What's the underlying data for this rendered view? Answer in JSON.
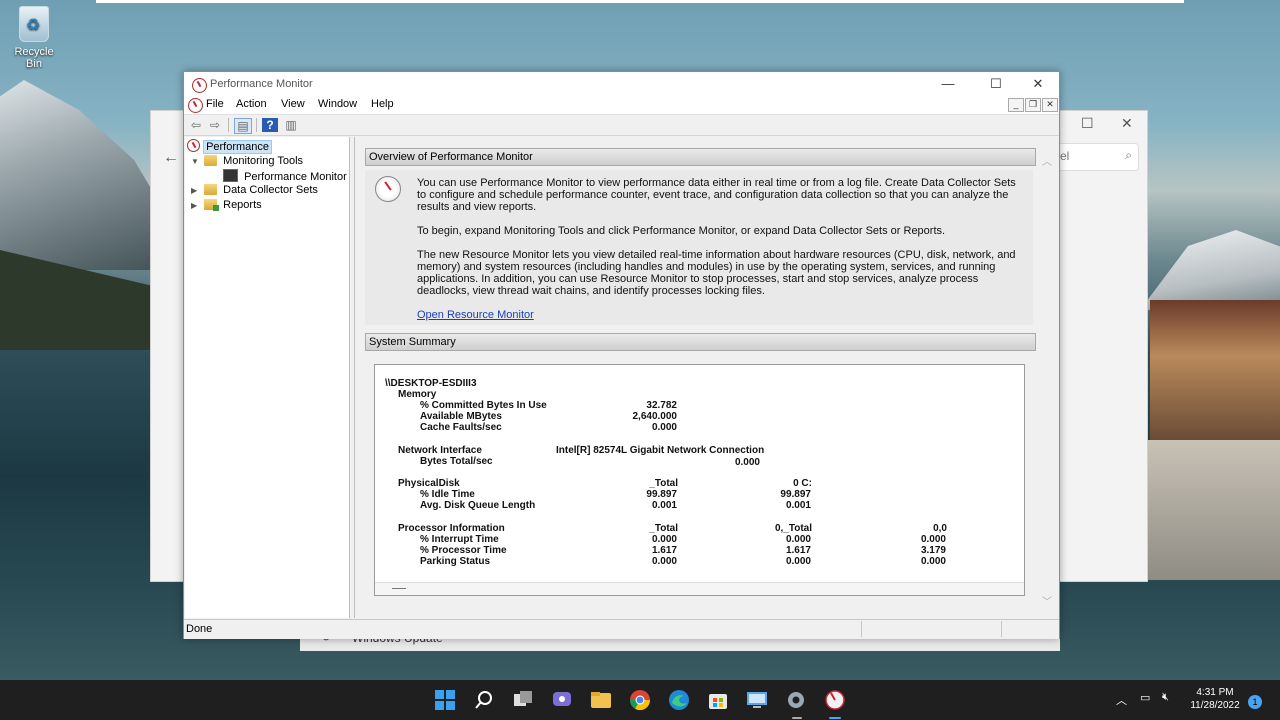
{
  "desktop": {
    "recycle_bin_label": "Recycle Bin"
  },
  "background_window": {
    "search_placeholder": "el",
    "windows_update_label": "Windows Update"
  },
  "window": {
    "title": "Performance Monitor",
    "menu": [
      "File",
      "Action",
      "View",
      "Window",
      "Help"
    ]
  },
  "tree": {
    "root": "Performance",
    "monitoring_tools": "Monitoring Tools",
    "performance_monitor": "Performance Monitor",
    "data_collector_sets": "Data Collector Sets",
    "reports": "Reports"
  },
  "overview": {
    "header": "Overview of Performance Monitor",
    "para1": "You can use Performance Monitor to view performance data either in real time or from a log file. Create Data Collector Sets to configure and schedule performance counter, event trace, and configuration data collection so that you can analyze the results and view reports.",
    "para2": "To begin, expand Monitoring Tools and click Performance Monitor, or expand Data Collector Sets or Reports.",
    "para3": "The new Resource Monitor lets you view detailed real-time information about hardware resources (CPU, disk, network, and memory) and system resources (including handles and modules) in use by the operating system, services, and running applications. In addition, you can use Resource Monitor to stop processes, start and stop services, analyze process deadlocks, view thread wait chains, and identify processes locking files.",
    "link": "Open Resource Monitor"
  },
  "summary": {
    "header": "System Summary",
    "computer": "\\\\DESKTOP-ESDIII3",
    "memory": {
      "label": "Memory",
      "committed_label": "% Committed Bytes In Use",
      "committed": "32.782",
      "available_label": "Available MBytes",
      "available": "2,640.000",
      "cache_label": "Cache Faults/sec",
      "cache": "0.000"
    },
    "network": {
      "label": "Network Interface",
      "adapter": "Intel[R] 82574L Gigabit Network Connection",
      "bytes_label": "Bytes Total/sec",
      "bytes": "0.000"
    },
    "disk": {
      "label": "PhysicalDisk",
      "col1": "_Total",
      "col2": "0 C:",
      "idle_label": "% Idle Time",
      "idle_total": "99.897",
      "idle_c": "99.897",
      "queue_label": "Avg. Disk Queue Length",
      "queue_total": "0.001",
      "queue_c": "0.001"
    },
    "processor": {
      "label": "Processor Information",
      "col1": "_Total",
      "col2": "0,_Total",
      "col3": "0,0",
      "interrupt_label": "% Interrupt Time",
      "interrupt": [
        "0.000",
        "0.000",
        "0.000"
      ],
      "proc_label": "% Processor Time",
      "proc": [
        "1.617",
        "1.617",
        "3.179"
      ],
      "parking_label": "Parking Status",
      "parking": [
        "0.000",
        "0.000",
        "0.000"
      ]
    }
  },
  "status": {
    "text": "Done"
  },
  "taskbar": {
    "time": "4:31 PM",
    "date": "11/28/2022",
    "notifications": "1",
    "icons": [
      "start-icon",
      "search-icon",
      "task-view-icon",
      "chat-icon",
      "file-explorer-icon",
      "chrome-icon",
      "edge-icon",
      "store-icon",
      "remote-desktop-icon",
      "settings-icon",
      "performance-monitor-icon"
    ]
  }
}
